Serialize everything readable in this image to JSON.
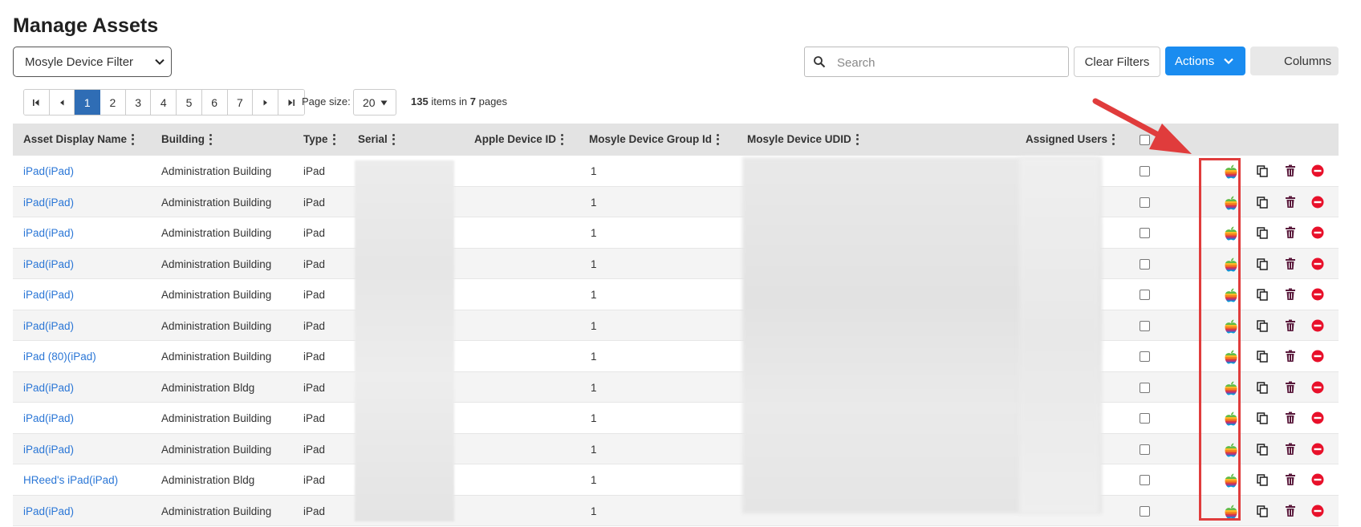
{
  "page": {
    "title": "Manage Assets"
  },
  "toolbar": {
    "filter_select": "Mosyle Device Filter",
    "search_placeholder": "Search",
    "clear_filters_label": "Clear Filters",
    "actions_label": "Actions",
    "columns_label": "Columns"
  },
  "pager": {
    "pages": [
      "1",
      "2",
      "3",
      "4",
      "5",
      "6",
      "7"
    ],
    "current_page": "1",
    "page_size_label": "Page size:",
    "page_size": "20",
    "items_count": "135",
    "items_text_mid": "items in",
    "pages_count": "7",
    "items_text_end": "pages"
  },
  "columns": {
    "asset_display_name": "Asset Display Name",
    "building": "Building",
    "type": "Type",
    "serial": "Serial",
    "apple_device_id": "Apple Device ID",
    "mosyle_device_group_id": "Mosyle Device Group Id",
    "mosyle_device_udid": "Mosyle Device UDID",
    "assigned_users": "Assigned Users"
  },
  "rows": [
    {
      "name": "iPad(iPad)",
      "building": "Administration Building",
      "type": "iPad",
      "group_id": "1"
    },
    {
      "name": "iPad(iPad)",
      "building": "Administration Building",
      "type": "iPad",
      "group_id": "1"
    },
    {
      "name": "iPad(iPad)",
      "building": "Administration Building",
      "type": "iPad",
      "group_id": "1"
    },
    {
      "name": "iPad(iPad)",
      "building": "Administration Building",
      "type": "iPad",
      "group_id": "1"
    },
    {
      "name": "iPad(iPad)",
      "building": "Administration Building",
      "type": "iPad",
      "group_id": "1"
    },
    {
      "name": "iPad(iPad)",
      "building": "Administration Building",
      "type": "iPad",
      "group_id": "1"
    },
    {
      "name": "iPad (80)(iPad)",
      "building": "Administration Building",
      "type": "iPad",
      "group_id": "1"
    },
    {
      "name": "iPad(iPad)",
      "building": "Administration Bldg",
      "type": "iPad",
      "group_id": "1"
    },
    {
      "name": "iPad(iPad)",
      "building": "Administration Building",
      "type": "iPad",
      "group_id": "1"
    },
    {
      "name": "iPad(iPad)",
      "building": "Administration Building",
      "type": "iPad",
      "group_id": "1"
    },
    {
      "name": "HReed's iPad(iPad)",
      "building": "Administration Bldg",
      "type": "iPad",
      "group_id": "1"
    },
    {
      "name": "iPad(iPad)",
      "building": "Administration Building",
      "type": "iPad",
      "group_id": "1"
    }
  ],
  "row_actions": [
    "apple-mosyle-icon",
    "copy-icon",
    "trash-icon",
    "remove-circle-icon"
  ],
  "colors": {
    "primary": "#1a8cf0",
    "pager_active": "#2f6db5",
    "link": "#2a76d6",
    "annotation": "#e03c3c",
    "delete": "#e8102a",
    "trash": "#5a1a3c"
  }
}
